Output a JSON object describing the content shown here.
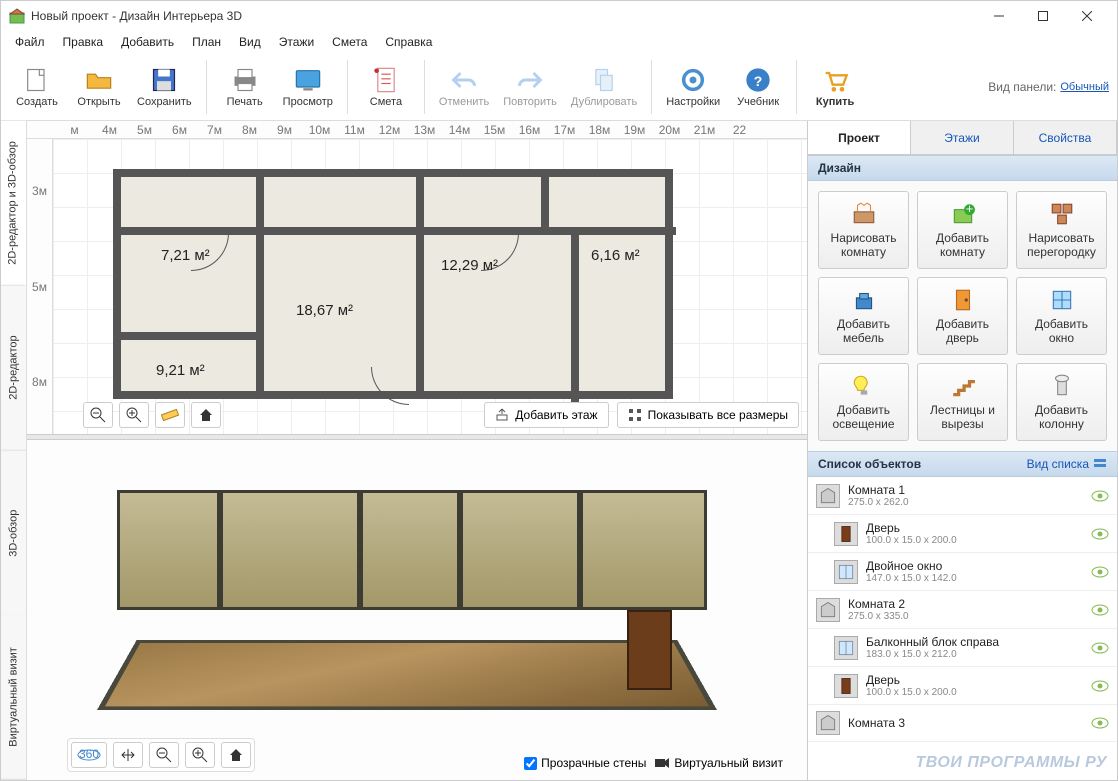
{
  "window": {
    "title": "Новый проект - Дизайн Интерьера 3D"
  },
  "menu": [
    "Файл",
    "Правка",
    "Добавить",
    "План",
    "Вид",
    "Этажи",
    "Смета",
    "Справка"
  ],
  "toolbar": {
    "create": "Создать",
    "open": "Открыть",
    "save": "Сохранить",
    "print": "Печать",
    "preview": "Просмотр",
    "estimate": "Смета",
    "undo": "Отменить",
    "redo": "Повторить",
    "duplicate": "Дублировать",
    "settings": "Настройки",
    "tutorial": "Учебник",
    "buy": "Купить",
    "panel_label": "Вид панели:",
    "panel_link": "Обычный"
  },
  "ruler_h": [
    "м",
    "4м",
    "5м",
    "6м",
    "7м",
    "8м",
    "9м",
    "10м",
    "11м",
    "12м",
    "13м",
    "14м",
    "15м",
    "16м",
    "17м",
    "18м",
    "19м",
    "20м",
    "21м",
    "22"
  ],
  "ruler_v": [
    "3м",
    "5м",
    "8м"
  ],
  "side_tabs": [
    "2D-редактор и 3D-обзор",
    "2D-редактор",
    "3D-обзор",
    "Виртуальный визит"
  ],
  "rooms": {
    "r1": "7,21 м²",
    "r2": "18,67 м²",
    "r3": "12,29 м²",
    "r4": "6,16 м²",
    "r5": "9,21 м²"
  },
  "floor_btns": {
    "add": "Добавить этаж",
    "show": "Показывать все размеры"
  },
  "view3d": {
    "transparent": "Прозрачные стены",
    "camera": "Виртуальный визит"
  },
  "rp_tabs": [
    "Проект",
    "Этажи",
    "Свойства"
  ],
  "rp_design": "Дизайн",
  "tools": [
    "Нарисовать комнату",
    "Добавить комнату",
    "Нарисовать перегородку",
    "Добавить мебель",
    "Добавить дверь",
    "Добавить окно",
    "Добавить освещение",
    "Лестницы и вырезы",
    "Добавить колонну"
  ],
  "list_title": "Список объектов",
  "list_view": "Вид списка",
  "objects": [
    {
      "name": "Комната 1",
      "dims": "275.0 x 262.0",
      "type": "room",
      "child": false
    },
    {
      "name": "Дверь",
      "dims": "100.0 x 15.0 x 200.0",
      "type": "door",
      "child": true
    },
    {
      "name": "Двойное окно",
      "dims": "147.0 x 15.0 x 142.0",
      "type": "window",
      "child": true
    },
    {
      "name": "Комната 2",
      "dims": "275.0 x 335.0",
      "type": "room",
      "child": false
    },
    {
      "name": "Балконный блок справа",
      "dims": "183.0 x 15.0 x 212.0",
      "type": "window",
      "child": true
    },
    {
      "name": "Дверь",
      "dims": "100.0 x 15.0 x 200.0",
      "type": "door",
      "child": true
    },
    {
      "name": "Комната 3",
      "dims": "",
      "type": "room",
      "child": false
    }
  ],
  "watermark": "ТВОИ ПРОГРАММЫ РУ"
}
